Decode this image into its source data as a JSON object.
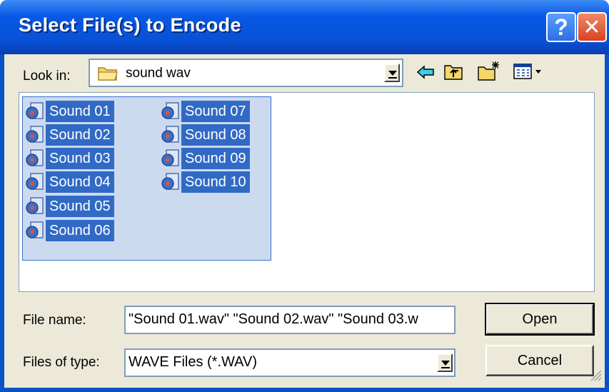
{
  "window": {
    "title": "Select File(s) to Encode",
    "help_label": "?",
    "close_label": "✕"
  },
  "lookin": {
    "label": "Look in:",
    "value": "sound wav"
  },
  "toolbar": {
    "back_icon": "back-arrow-icon",
    "up_icon": "up-folder-icon",
    "new_folder_icon": "new-folder-icon",
    "view_menu_icon": "view-menu-icon"
  },
  "files": [
    "Sound 01",
    "Sound 02",
    "Sound 03",
    "Sound 04",
    "Sound 05",
    "Sound 06",
    "Sound 07",
    "Sound 08",
    "Sound 09",
    "Sound 10"
  ],
  "filename": {
    "label": "File name:",
    "value": "\"Sound 01.wav\" \"Sound 02.wav\" \"Sound 03.w"
  },
  "filetype": {
    "label": "Files of type:",
    "value": "WAVE Files (*.WAV)"
  },
  "buttons": {
    "open": "Open",
    "cancel": "Cancel"
  },
  "colors": {
    "title_blue": "#0858e6",
    "selection": "#316ac5",
    "dialog_bg": "#ece9d8"
  }
}
